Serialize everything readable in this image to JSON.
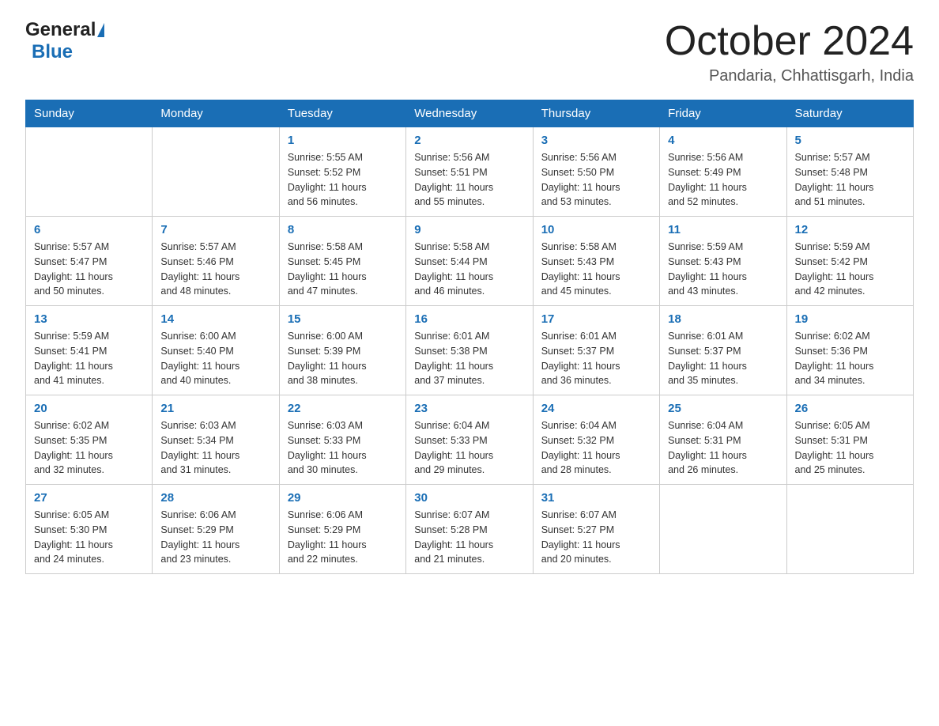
{
  "header": {
    "month_title": "October 2024",
    "location": "Pandaria, Chhattisgarh, India",
    "logo_general": "General",
    "logo_blue": "Blue"
  },
  "days_of_week": [
    "Sunday",
    "Monday",
    "Tuesday",
    "Wednesday",
    "Thursday",
    "Friday",
    "Saturday"
  ],
  "weeks": [
    [
      {
        "day": "",
        "info": ""
      },
      {
        "day": "",
        "info": ""
      },
      {
        "day": "1",
        "info": "Sunrise: 5:55 AM\nSunset: 5:52 PM\nDaylight: 11 hours\nand 56 minutes."
      },
      {
        "day": "2",
        "info": "Sunrise: 5:56 AM\nSunset: 5:51 PM\nDaylight: 11 hours\nand 55 minutes."
      },
      {
        "day": "3",
        "info": "Sunrise: 5:56 AM\nSunset: 5:50 PM\nDaylight: 11 hours\nand 53 minutes."
      },
      {
        "day": "4",
        "info": "Sunrise: 5:56 AM\nSunset: 5:49 PM\nDaylight: 11 hours\nand 52 minutes."
      },
      {
        "day": "5",
        "info": "Sunrise: 5:57 AM\nSunset: 5:48 PM\nDaylight: 11 hours\nand 51 minutes."
      }
    ],
    [
      {
        "day": "6",
        "info": "Sunrise: 5:57 AM\nSunset: 5:47 PM\nDaylight: 11 hours\nand 50 minutes."
      },
      {
        "day": "7",
        "info": "Sunrise: 5:57 AM\nSunset: 5:46 PM\nDaylight: 11 hours\nand 48 minutes."
      },
      {
        "day": "8",
        "info": "Sunrise: 5:58 AM\nSunset: 5:45 PM\nDaylight: 11 hours\nand 47 minutes."
      },
      {
        "day": "9",
        "info": "Sunrise: 5:58 AM\nSunset: 5:44 PM\nDaylight: 11 hours\nand 46 minutes."
      },
      {
        "day": "10",
        "info": "Sunrise: 5:58 AM\nSunset: 5:43 PM\nDaylight: 11 hours\nand 45 minutes."
      },
      {
        "day": "11",
        "info": "Sunrise: 5:59 AM\nSunset: 5:43 PM\nDaylight: 11 hours\nand 43 minutes."
      },
      {
        "day": "12",
        "info": "Sunrise: 5:59 AM\nSunset: 5:42 PM\nDaylight: 11 hours\nand 42 minutes."
      }
    ],
    [
      {
        "day": "13",
        "info": "Sunrise: 5:59 AM\nSunset: 5:41 PM\nDaylight: 11 hours\nand 41 minutes."
      },
      {
        "day": "14",
        "info": "Sunrise: 6:00 AM\nSunset: 5:40 PM\nDaylight: 11 hours\nand 40 minutes."
      },
      {
        "day": "15",
        "info": "Sunrise: 6:00 AM\nSunset: 5:39 PM\nDaylight: 11 hours\nand 38 minutes."
      },
      {
        "day": "16",
        "info": "Sunrise: 6:01 AM\nSunset: 5:38 PM\nDaylight: 11 hours\nand 37 minutes."
      },
      {
        "day": "17",
        "info": "Sunrise: 6:01 AM\nSunset: 5:37 PM\nDaylight: 11 hours\nand 36 minutes."
      },
      {
        "day": "18",
        "info": "Sunrise: 6:01 AM\nSunset: 5:37 PM\nDaylight: 11 hours\nand 35 minutes."
      },
      {
        "day": "19",
        "info": "Sunrise: 6:02 AM\nSunset: 5:36 PM\nDaylight: 11 hours\nand 34 minutes."
      }
    ],
    [
      {
        "day": "20",
        "info": "Sunrise: 6:02 AM\nSunset: 5:35 PM\nDaylight: 11 hours\nand 32 minutes."
      },
      {
        "day": "21",
        "info": "Sunrise: 6:03 AM\nSunset: 5:34 PM\nDaylight: 11 hours\nand 31 minutes."
      },
      {
        "day": "22",
        "info": "Sunrise: 6:03 AM\nSunset: 5:33 PM\nDaylight: 11 hours\nand 30 minutes."
      },
      {
        "day": "23",
        "info": "Sunrise: 6:04 AM\nSunset: 5:33 PM\nDaylight: 11 hours\nand 29 minutes."
      },
      {
        "day": "24",
        "info": "Sunrise: 6:04 AM\nSunset: 5:32 PM\nDaylight: 11 hours\nand 28 minutes."
      },
      {
        "day": "25",
        "info": "Sunrise: 6:04 AM\nSunset: 5:31 PM\nDaylight: 11 hours\nand 26 minutes."
      },
      {
        "day": "26",
        "info": "Sunrise: 6:05 AM\nSunset: 5:31 PM\nDaylight: 11 hours\nand 25 minutes."
      }
    ],
    [
      {
        "day": "27",
        "info": "Sunrise: 6:05 AM\nSunset: 5:30 PM\nDaylight: 11 hours\nand 24 minutes."
      },
      {
        "day": "28",
        "info": "Sunrise: 6:06 AM\nSunset: 5:29 PM\nDaylight: 11 hours\nand 23 minutes."
      },
      {
        "day": "29",
        "info": "Sunrise: 6:06 AM\nSunset: 5:29 PM\nDaylight: 11 hours\nand 22 minutes."
      },
      {
        "day": "30",
        "info": "Sunrise: 6:07 AM\nSunset: 5:28 PM\nDaylight: 11 hours\nand 21 minutes."
      },
      {
        "day": "31",
        "info": "Sunrise: 6:07 AM\nSunset: 5:27 PM\nDaylight: 11 hours\nand 20 minutes."
      },
      {
        "day": "",
        "info": ""
      },
      {
        "day": "",
        "info": ""
      }
    ]
  ]
}
